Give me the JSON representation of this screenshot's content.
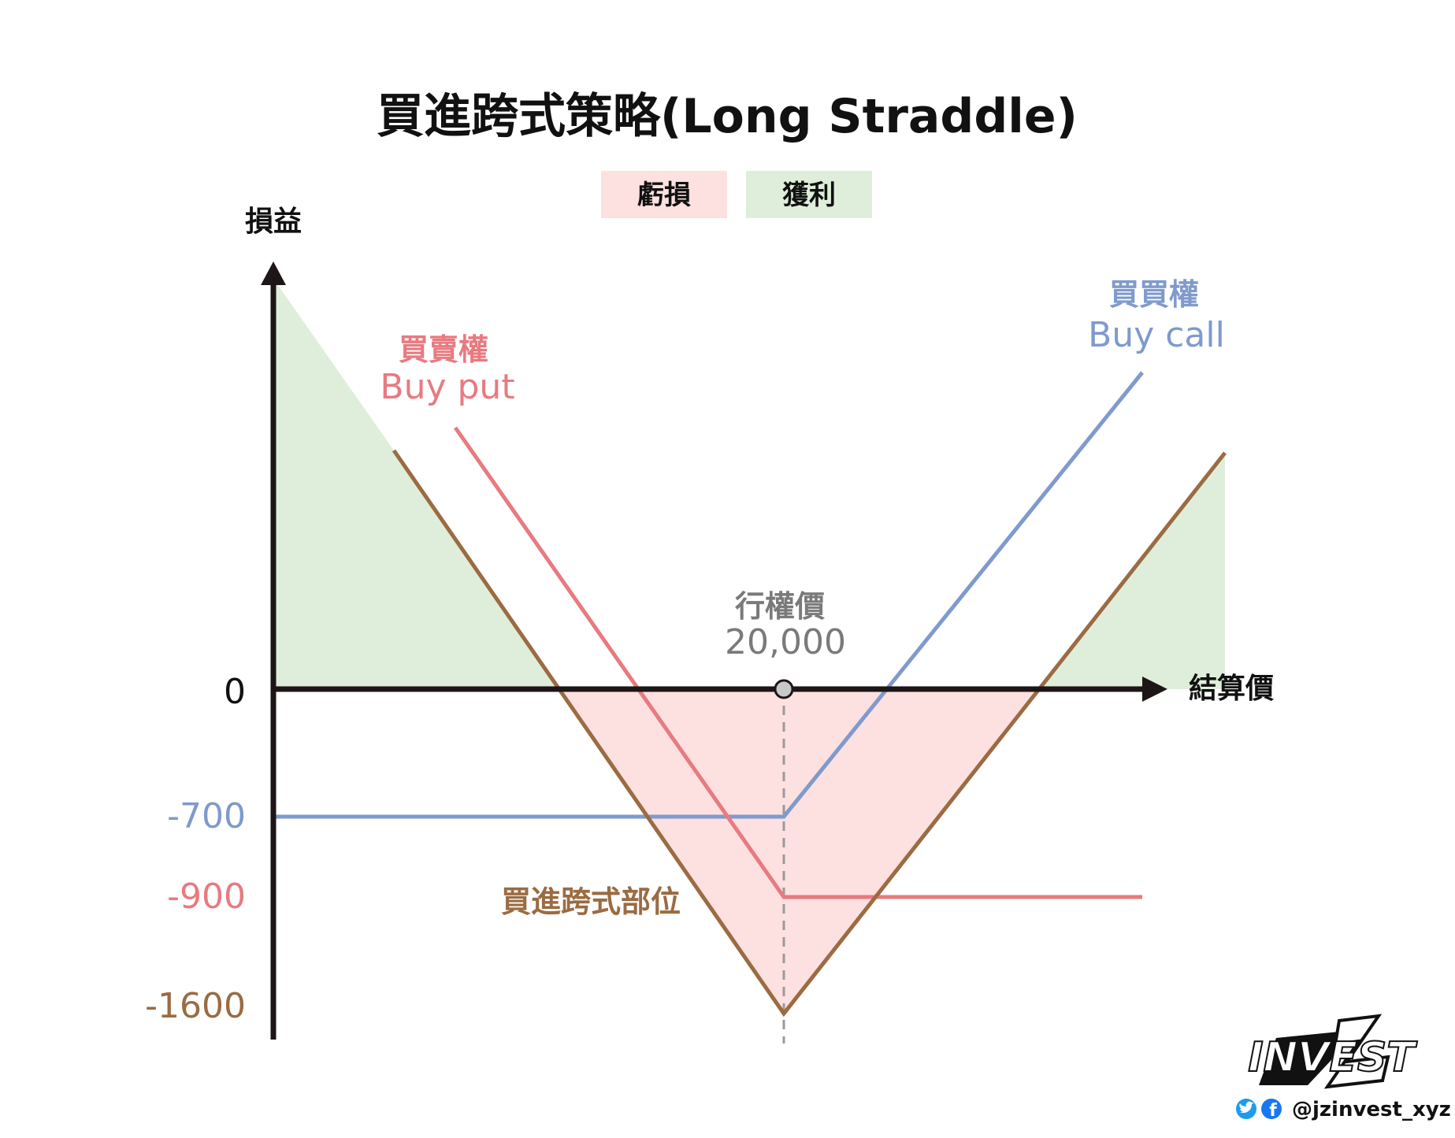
{
  "title": "買進跨式策略(Long Straddle)",
  "legend": {
    "loss": {
      "label": "虧損",
      "color": "#fde0e0"
    },
    "profit": {
      "label": "獲利",
      "color": "#dfeeda"
    }
  },
  "axes": {
    "y_label": "損益",
    "x_label": "結算價",
    "zero_label": "0"
  },
  "strike": {
    "label": "行權價",
    "value_label": "20,000"
  },
  "levels": [
    {
      "label": "-700",
      "value": -700,
      "color": "#7f9acc"
    },
    {
      "label": "-900",
      "value": -900,
      "color": "#e87a80"
    },
    {
      "label": "-1600",
      "value": -1600,
      "color": "#9b6b42"
    }
  ],
  "series_labels": {
    "put": {
      "line1": "買賣權",
      "line2": "Buy put",
      "color": "#e87a80"
    },
    "call": {
      "line1": "買買權",
      "line2": "Buy call",
      "color": "#7f9acc"
    },
    "position": {
      "text": "買進跨式部位",
      "color": "#9b6b42"
    }
  },
  "colors": {
    "axis": "#1e1616",
    "dash": "#9a9a9a",
    "strike_dot": "#c8c8c8",
    "strike_text": "#7a7a7a"
  },
  "brand": {
    "logo_text": "INVEST",
    "handle": "@jzinvest_xyz",
    "icons": [
      "twitter-icon",
      "facebook-icon"
    ]
  }
}
